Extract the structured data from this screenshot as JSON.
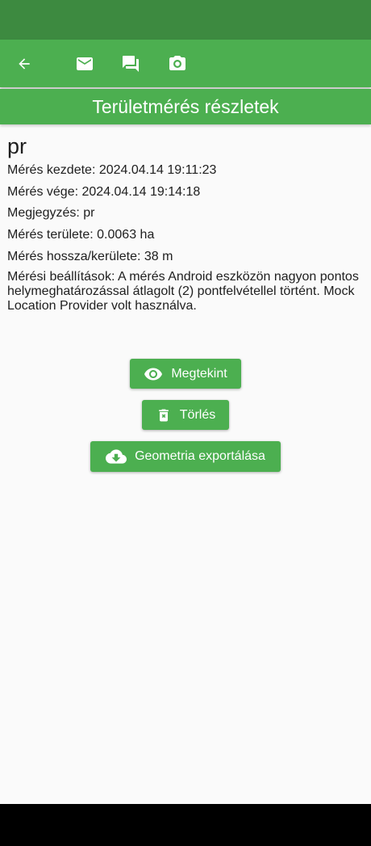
{
  "header": {
    "title": "Területmérés részletek",
    "icons": [
      "arrow-back-icon",
      "mail-icon",
      "chat-icon",
      "camera-icon"
    ]
  },
  "measurement": {
    "name": "pr",
    "start": "Mérés kezdete: 2024.04.14 19:11:23",
    "end": "Mérés vége: 2024.04.14 19:14:18",
    "note": "Megjegyzés: pr",
    "area": "Mérés területe: 0.0063 ha",
    "perimeter": "Mérés hossza/kerülete: 38 m",
    "settings": "Mérési beállítások: A mérés Android eszközön nagyon pontos helymeghatározással átlagolt (2) pontfelvétellel történt. Mock Location Provider volt használva."
  },
  "actions": {
    "view_label": "Megtekint",
    "delete_label": "Törlés",
    "export_label": "Geometria exportálása"
  },
  "colors": {
    "primary": "#4caf50",
    "status_bar": "#3d8a40",
    "background": "#fafafa",
    "nav_bar": "#000000"
  }
}
